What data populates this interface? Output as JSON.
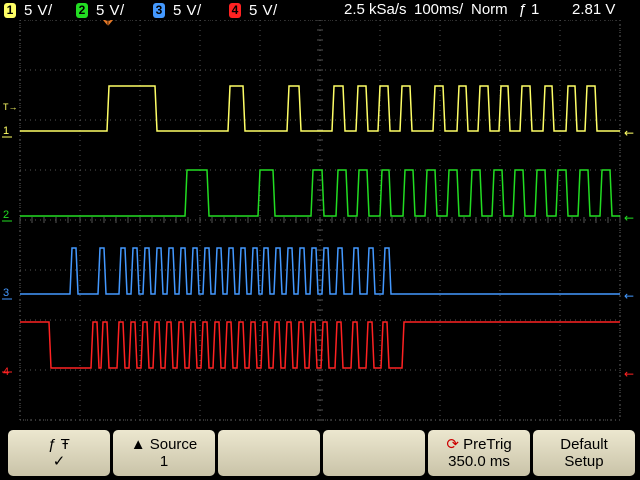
{
  "header": {
    "channels": [
      {
        "number": "1",
        "scale": "5 V/",
        "color": "#ffff66"
      },
      {
        "number": "2",
        "scale": "5 V/",
        "color": "#22dd22"
      },
      {
        "number": "3",
        "scale": "5 V/",
        "color": "#4499ff"
      },
      {
        "number": "4",
        "scale": "5 V/",
        "color": "#ff2222"
      }
    ],
    "sample_rate": "2.5 kSa/s",
    "timebase": "100ms/",
    "trigger_mode": "Norm",
    "trigger_edge_icon": "rising-edge-icon",
    "trigger_source": "1",
    "trigger_level": "2.81 V"
  },
  "display": {
    "trigger_marker": "T",
    "channel_labels": [
      {
        "number": "1",
        "color": "#ffff66"
      },
      {
        "number": "2",
        "color": "#22dd22"
      },
      {
        "number": "3",
        "color": "#4499ff"
      },
      {
        "number": "4",
        "color": "#ff2222"
      }
    ]
  },
  "softkeys": [
    {
      "line1": "ƒ   Ŧ",
      "line2": "✓"
    },
    {
      "line1": "▲ Source",
      "line2": "1"
    },
    {
      "line1": "",
      "line2": ""
    },
    {
      "line1": "",
      "line2": ""
    },
    {
      "line1": "PreTrig",
      "line2": "350.0 ms"
    },
    {
      "line1": "Default",
      "line2": "Setup"
    }
  ],
  "colors": {
    "grid": "#555555",
    "background": "#000000",
    "softkey": "#ddd7bd"
  }
}
